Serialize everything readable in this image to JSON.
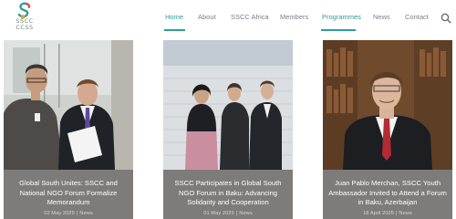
{
  "logo": {
    "text_line1": "SSCC",
    "text_line2": "CCSS"
  },
  "nav": {
    "items": [
      {
        "label": "Home",
        "active": true
      },
      {
        "label": "About",
        "active": false
      },
      {
        "label": "SSCC Africa",
        "active": false
      },
      {
        "label": "Members",
        "active": false
      },
      {
        "label": "Programmes",
        "active": true
      },
      {
        "label": "News",
        "active": false
      },
      {
        "label": "Contact",
        "active": false
      }
    ],
    "search_icon": "search-icon",
    "accent_color": "#2e9e8f"
  },
  "cards": [
    {
      "title": "Global South Unites: SSCC and National NGO Forum Formalize Memorandum",
      "date": "02 May 2025",
      "category": "News"
    },
    {
      "title": "SSCC Participates in Global South NGO Forum in Baku: Advancing Solidarity and Cooperation",
      "date": "01 May 2025",
      "category": "News"
    },
    {
      "title": "Juan Pablo Merchan, SSCC Youth Ambassador Invited to Attend a Forum in Baku, Azerbaijan",
      "date": "18 April 2025",
      "category": "News"
    }
  ],
  "meta_separator": "|"
}
